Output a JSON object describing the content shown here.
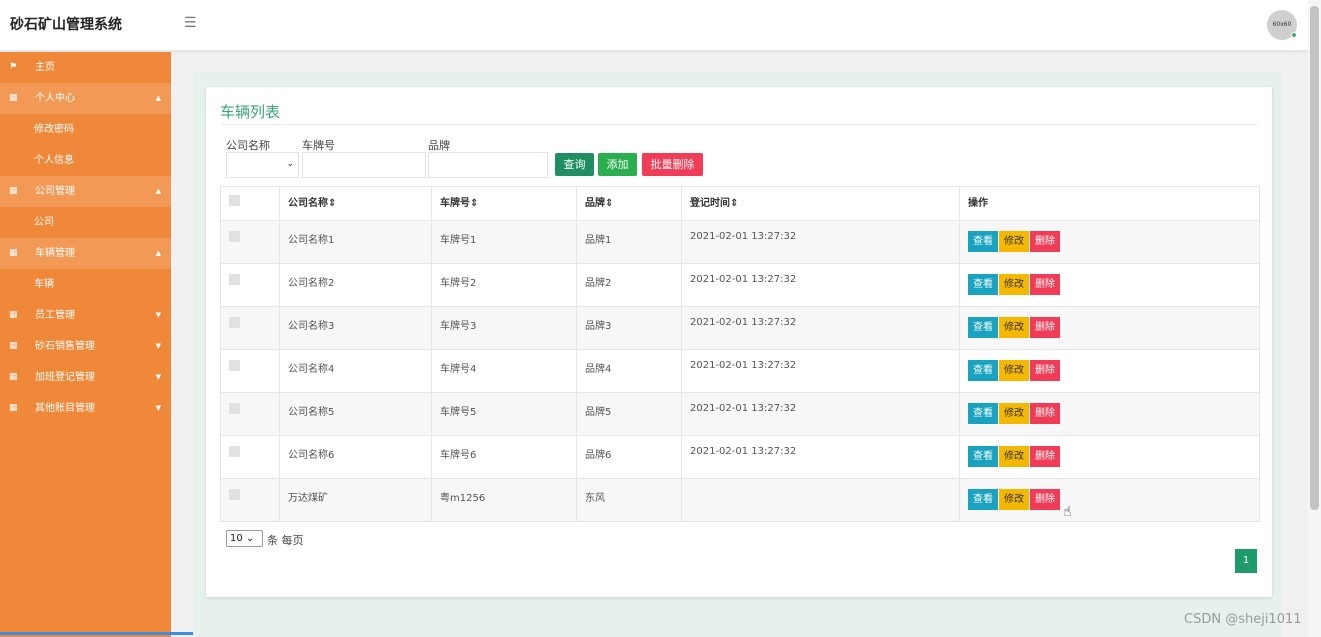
{
  "header": {
    "app_title": "砂石矿山管理系统",
    "avatar_text": "60x60"
  },
  "sidebar": {
    "items": [
      {
        "label": "主页"
      },
      {
        "label": "个人中心",
        "subs": [
          "修改密码",
          "个人信息"
        ]
      },
      {
        "label": "公司管理",
        "subs": [
          "公司"
        ]
      },
      {
        "label": "车辆管理",
        "subs": [
          "车辆"
        ]
      },
      {
        "label": "员工管理"
      },
      {
        "label": "砂石销售管理"
      },
      {
        "label": "加班登记管理"
      },
      {
        "label": "其他账目管理"
      }
    ]
  },
  "main": {
    "title": "车辆列表",
    "filters": {
      "company_label": "公司名称",
      "plate_label": "车牌号",
      "brand_label": "品牌"
    },
    "buttons": {
      "search": "查询",
      "add": "添加",
      "batch_delete": "批量删除"
    },
    "table": {
      "headers": [
        "公司名称",
        "车牌号",
        "品牌",
        "登记时间",
        "操作"
      ],
      "sort_marks": "⇕",
      "rows": [
        {
          "company": "公司名称1",
          "plate": "车牌号1",
          "brand": "品牌1",
          "time": "2021-02-01 13:27:32"
        },
        {
          "company": "公司名称2",
          "plate": "车牌号2",
          "brand": "品牌2",
          "time": "2021-02-01 13:27:32"
        },
        {
          "company": "公司名称3",
          "plate": "车牌号3",
          "brand": "品牌3",
          "time": "2021-02-01 13:27:32"
        },
        {
          "company": "公司名称4",
          "plate": "车牌号4",
          "brand": "品牌4",
          "time": "2021-02-01 13:27:32"
        },
        {
          "company": "公司名称5",
          "plate": "车牌号5",
          "brand": "品牌5",
          "time": "2021-02-01 13:27:32"
        },
        {
          "company": "公司名称6",
          "plate": "车牌号6",
          "brand": "品牌6",
          "time": "2021-02-01 13:27:32"
        },
        {
          "company": "万达煤矿",
          "plate": "粤m1256",
          "brand": "东风",
          "time": ""
        }
      ],
      "row_actions": {
        "view": "查看",
        "edit": "修改",
        "delete": "删除"
      }
    },
    "pagination": {
      "page_size": "10",
      "per_page_label": "条 每页",
      "current_page": "1"
    }
  },
  "watermark": "CSDN @sheji1011",
  "colors": {
    "sidebar": "#f0883a",
    "accent_green": "#3aa776",
    "view": "#1aa3c0",
    "edit": "#f5b800",
    "delete": "#f03c56"
  }
}
